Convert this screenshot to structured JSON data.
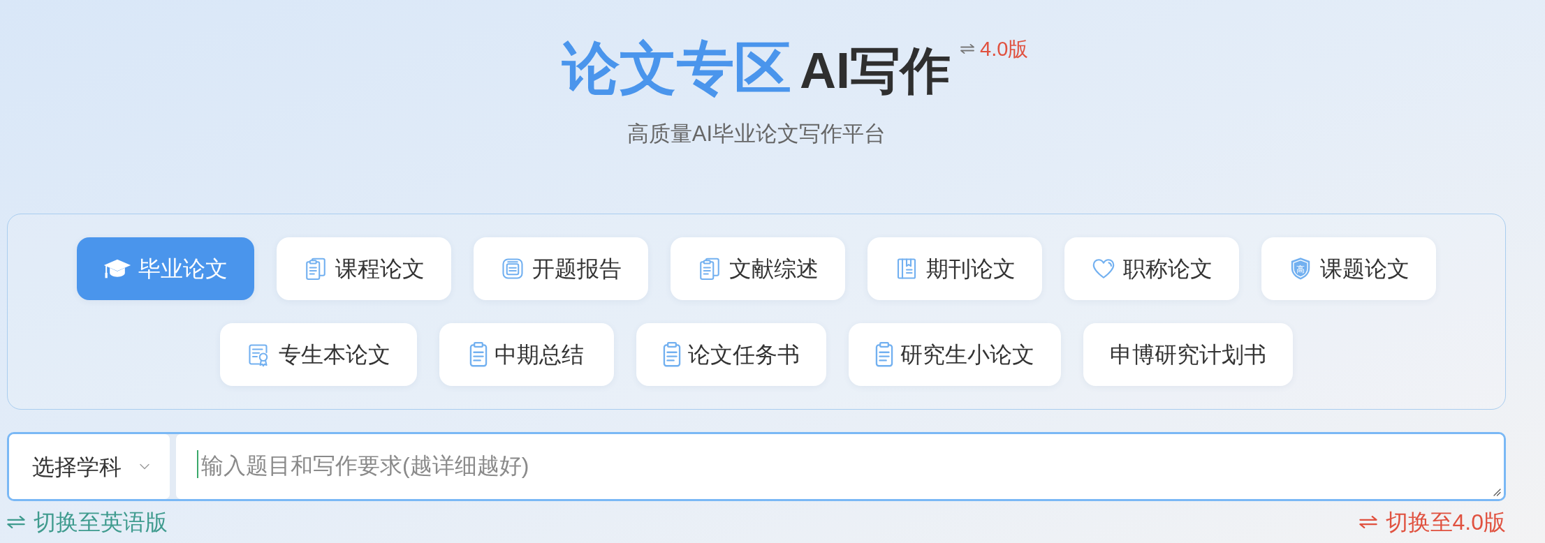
{
  "header": {
    "title_highlight": "论文专区",
    "title_rest": "AI写作",
    "version_link": "4.0版",
    "subtitle": "高质量AI毕业论文写作平台"
  },
  "tabs": [
    {
      "label": "毕业论文",
      "selected": true
    },
    {
      "label": "课程论文",
      "selected": false
    },
    {
      "label": "开题报告",
      "selected": false
    },
    {
      "label": "文献综述",
      "selected": false
    },
    {
      "label": "期刊论文",
      "selected": false
    },
    {
      "label": "职称论文",
      "selected": false
    },
    {
      "label": "课题论文",
      "selected": false,
      "icon_text": "高"
    },
    {
      "label": "专生本论文",
      "selected": false
    },
    {
      "label": "中期总结",
      "selected": false
    },
    {
      "label": "论文任务书",
      "selected": false
    },
    {
      "label": "研究生小论文",
      "selected": false
    },
    {
      "label": "申博研究计划书",
      "selected": false
    }
  ],
  "prompt": {
    "subject_select": "选择学科",
    "placeholder": "输入题目和写作要求(越详细越好)",
    "focused": true
  },
  "footer_links": [
    {
      "label": "切换至英语版",
      "kind": "language"
    },
    {
      "label": "切换至4.0版",
      "kind": "version"
    }
  ]
}
